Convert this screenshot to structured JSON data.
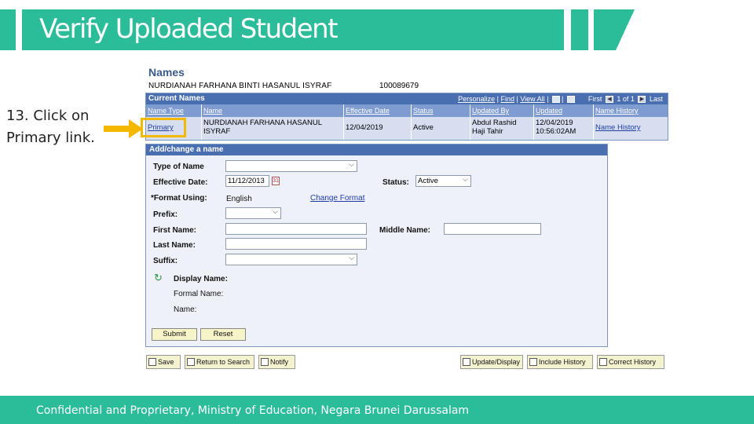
{
  "slide": {
    "title": "Verify Uploaded Student",
    "instruction_line1": "13. Click on",
    "instruction_line2": "Primary link.",
    "footer": "Confidential and Proprietary, Ministry of Education, Negara Brunei Darussalam",
    "accent_color": "#2bbc9a",
    "highlight_color": "#f5b800"
  },
  "names": {
    "heading": "Names",
    "person_name": "NURDIANAH FARHANA BINTI HASANUL ISYRAF",
    "person_id": "100089679"
  },
  "current_names": {
    "title": "Current Names",
    "tools": {
      "personalize": "Personalize",
      "find": "Find",
      "view_all": "View All",
      "first": "First",
      "pagination": "1 of 1",
      "last": "Last"
    },
    "columns": [
      "Name Type",
      "Name",
      "Effective Date",
      "Status",
      "Updated By",
      "Updated",
      "Name History"
    ],
    "row": {
      "name_type": "Primary",
      "name_line1": "NURDIANAH FARHANA HASANUL",
      "name_line2": "ISYRAF",
      "effective_date": "12/04/2019",
      "status": "Active",
      "updated_by_line1": "Abdul Rashid",
      "updated_by_line2": "Haji Tahir",
      "updated_line1": "12/04/2019",
      "updated_line2": "10:56:02AM",
      "name_history": "Name History"
    }
  },
  "add_change": {
    "title": "Add/change a name",
    "type_of_name_label": "Type of Name",
    "type_of_name_value": "",
    "effective_date_label": "Effective Date:",
    "effective_date_value": "11/12/2013",
    "status_label": "Status:",
    "status_value": "Active",
    "format_using_label": "*Format Using:",
    "format_using_value": "English",
    "change_format_link": "Change Format",
    "prefix_label": "Prefix:",
    "first_name_label": "First Name:",
    "middle_name_label": "Middle Name:",
    "last_name_label": "Last Name:",
    "suffix_label": "Suffix:",
    "display_name_label": "Display Name:",
    "formal_name_label": "Formal Name:",
    "name_label": "Name:",
    "submit_button": "Submit",
    "reset_button": "Reset"
  },
  "toolbar": {
    "save": "Save",
    "return_to_search": "Return to Search",
    "notify": "Notify",
    "update_display": "Update/Display",
    "include_history": "Include History",
    "correct_history": "Correct History"
  }
}
